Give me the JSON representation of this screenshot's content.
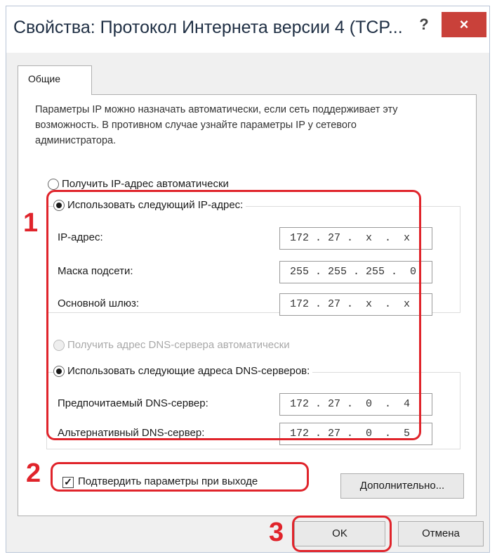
{
  "window": {
    "title": "Свойства: Протокол Интернета версии 4 (TCP...",
    "help_label": "?",
    "close_label": "×"
  },
  "tabs": [
    "Общие"
  ],
  "description": "Параметры IP можно назначать автоматически, если сеть поддерживает эту возможность. В противном случае узнайте параметры IP у сетевого администратора.",
  "ip_section": {
    "auto_label": "Получить IP-адрес автоматически",
    "manual_label": "Использовать следующий IP-адрес:",
    "selected": "manual",
    "fields": [
      {
        "label": "IP-адрес:",
        "value": "172 . 27 .  x  .  x"
      },
      {
        "label": "Маска подсети:",
        "value": "255 . 255 . 255 .  0"
      },
      {
        "label": "Основной шлюз:",
        "value": "172 . 27 .  x  .  x"
      }
    ]
  },
  "dns_section": {
    "auto_label": "Получить адрес DNS-сервера автоматически",
    "manual_label": "Использовать следующие адреса DNS-серверов:",
    "selected": "manual",
    "fields": [
      {
        "label": "Предпочитаемый DNS-сервер:",
        "value": "172 . 27 .  0  .  4"
      },
      {
        "label": "Альтернативный DNS-сервер:",
        "value": "172 . 27 .  0  .  5"
      }
    ]
  },
  "validate_checkbox": {
    "label": "Подтвердить параметры при выходе",
    "checked": true,
    "mark": "✓"
  },
  "buttons": {
    "advanced": "Дополнительно...",
    "ok": "OK",
    "cancel": "Отмена"
  },
  "annotations": {
    "n1": "1",
    "n2": "2",
    "n3": "3",
    "color": "#e0242b"
  }
}
